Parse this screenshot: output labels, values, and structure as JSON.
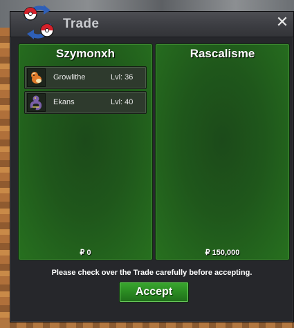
{
  "window": {
    "title": "Trade"
  },
  "left_panel": {
    "player_name": "Szymonxh",
    "pokemon": [
      {
        "name": "Growlithe",
        "level": "Lvl: 36"
      },
      {
        "name": "Ekans",
        "level": "Lvl: 40"
      }
    ],
    "money": "₽ 0"
  },
  "right_panel": {
    "player_name": "Rascalisme",
    "pokemon": [],
    "money": "₽ 150,000"
  },
  "notice": "Please check over the Trade carefully before accepting.",
  "accept_label": "Accept",
  "close_glyph": "✕",
  "icons": {
    "trade": "trade-swap-icon",
    "close": "close-icon",
    "pokemon_1": "growlithe-sprite-icon",
    "pokemon_2": "ekans-sprite-icon"
  },
  "colors": {
    "panel_green": "#1f571b",
    "accept_green": "#2a8a22",
    "window_bg": "#26272b"
  }
}
